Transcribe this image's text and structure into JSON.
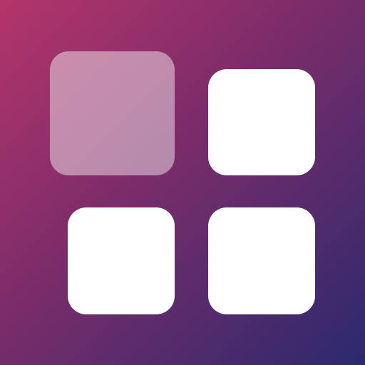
{
  "icon": {
    "name": "grid-widgets-icon",
    "gradient_start": "#b4356a",
    "gradient_mid": "#7a2c6a",
    "gradient_end": "#2b2a6e",
    "tiles": [
      {
        "id": "top-left",
        "color": "#ffffff",
        "opacity": 0.45,
        "state": "highlighted"
      },
      {
        "id": "top-right",
        "color": "#ffffff",
        "opacity": 1
      },
      {
        "id": "bottom-left",
        "color": "#ffffff",
        "opacity": 1
      },
      {
        "id": "bottom-right",
        "color": "#ffffff",
        "opacity": 1
      }
    ]
  }
}
